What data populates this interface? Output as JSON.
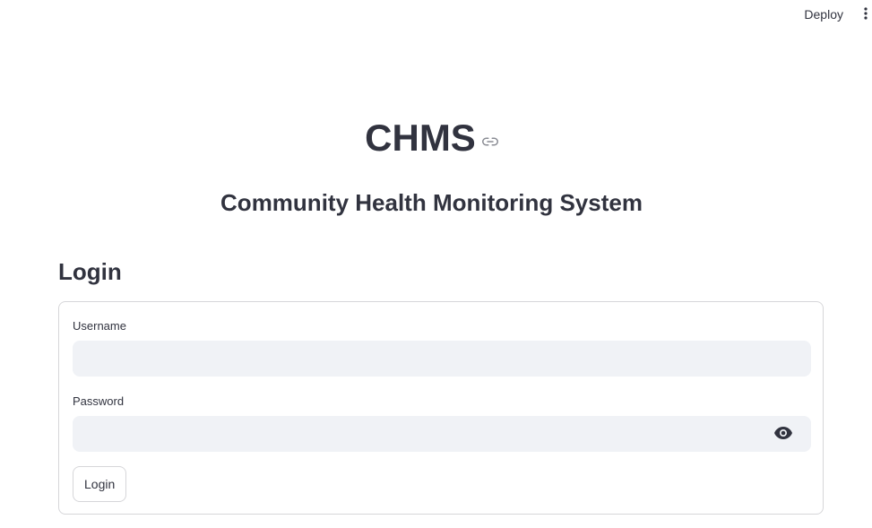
{
  "toolbar": {
    "deploy_label": "Deploy",
    "menu_icon": "more-vertical-icon"
  },
  "header": {
    "title": "CHMS",
    "title_link_icon": "link-icon",
    "subtitle": "Community Health Monitoring System"
  },
  "login": {
    "heading": "Login",
    "username": {
      "label": "Username",
      "value": "",
      "placeholder": ""
    },
    "password": {
      "label": "Password",
      "value": "",
      "placeholder": "",
      "toggle_icon": "eye-icon"
    },
    "submit_label": "Login"
  },
  "colors": {
    "text": "#31333f",
    "input_background": "#f0f2f6",
    "border": "#d6d6d9",
    "background": "#ffffff"
  }
}
